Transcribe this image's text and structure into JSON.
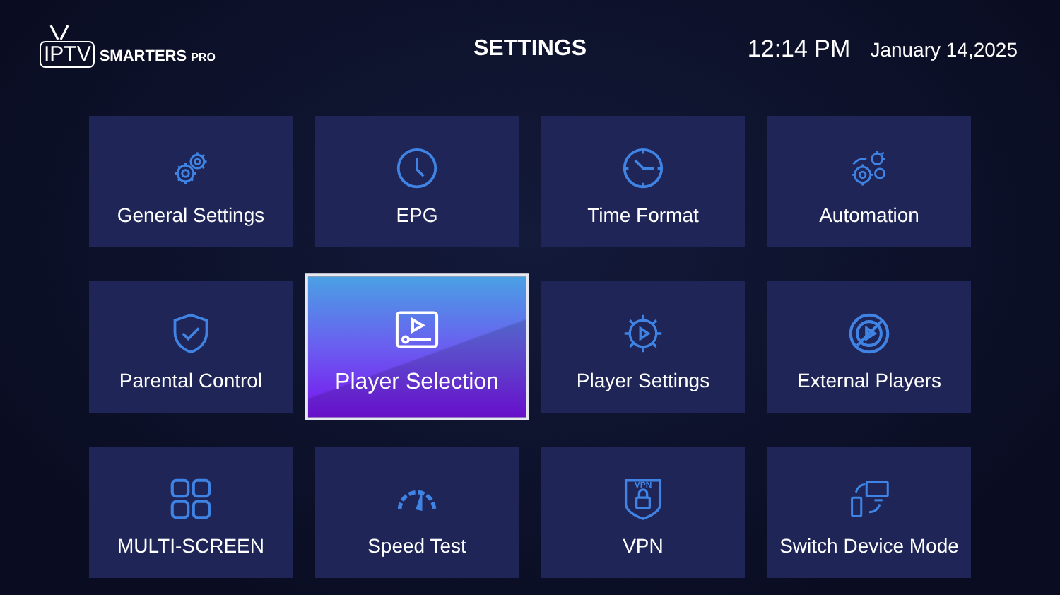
{
  "logo": {
    "iptv": "IPTV",
    "smarters": "SMARTERS",
    "pro": "PRO"
  },
  "title": "SETTINGS",
  "time": "12:14 PM",
  "date": "January 14,2025",
  "tiles": [
    {
      "label": "General Settings",
      "selected": false
    },
    {
      "label": "EPG",
      "selected": false
    },
    {
      "label": "Time Format",
      "selected": false
    },
    {
      "label": "Automation",
      "selected": false
    },
    {
      "label": "Parental Control",
      "selected": false
    },
    {
      "label": "Player Selection",
      "selected": true
    },
    {
      "label": "Player Settings",
      "selected": false
    },
    {
      "label": "External Players",
      "selected": false
    },
    {
      "label": "MULTI-SCREEN",
      "selected": false
    },
    {
      "label": "Speed Test",
      "selected": false
    },
    {
      "label": "VPN",
      "icon_text": "VPN",
      "selected": false
    },
    {
      "label": "Switch Device Mode",
      "selected": false
    }
  ]
}
